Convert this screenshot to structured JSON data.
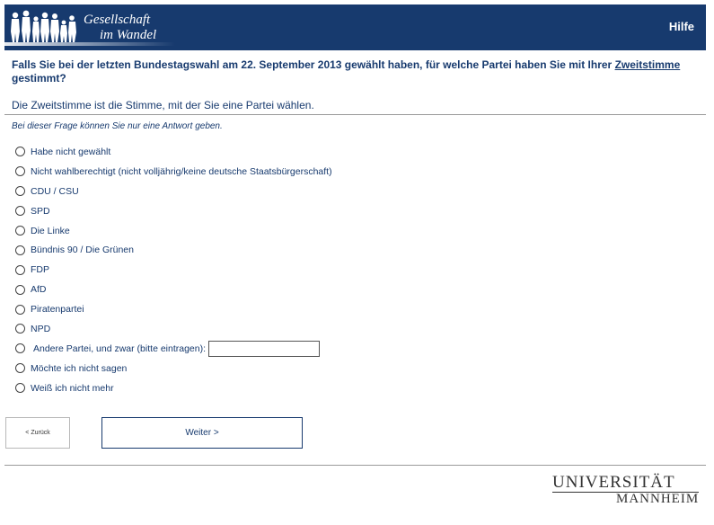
{
  "header": {
    "logo_line1": "Gesellschaft",
    "logo_line2": "im Wandel",
    "help_label": "Hilfe"
  },
  "question": {
    "text_before": "Falls Sie bei der letzten Bundestagswahl am 22. September 2013 gewählt haben, für welche Partei haben Sie mit Ihrer ",
    "link_text": "Zweitstimme",
    "text_after": " gestimmt?",
    "explanation": "Die Zweitstimme ist die Stimme, mit der Sie eine Partei wählen.",
    "instruction": "Bei dieser Frage können Sie nur eine Antwort geben."
  },
  "options": [
    "Habe nicht gewählt",
    "Nicht wahlberechtigt (nicht volljährig/keine deutsche Staatsbürgerschaft)",
    "CDU / CSU",
    "SPD",
    "Die Linke",
    "Bündnis 90 / Die Grünen",
    "FDP",
    "AfD",
    "Piratenpartei",
    "NPD",
    "Andere Partei, und zwar (bitte eintragen):",
    "Möchte ich nicht sagen",
    "Weiß ich nicht mehr"
  ],
  "other_input": {
    "value": ""
  },
  "nav": {
    "back_label": "< Zurück",
    "next_label": "Weiter >"
  },
  "footer": {
    "uni_line1": "UNIVERSITÄT",
    "uni_line2": "MANNHEIM"
  },
  "colors": {
    "brand": "#173a6e"
  }
}
